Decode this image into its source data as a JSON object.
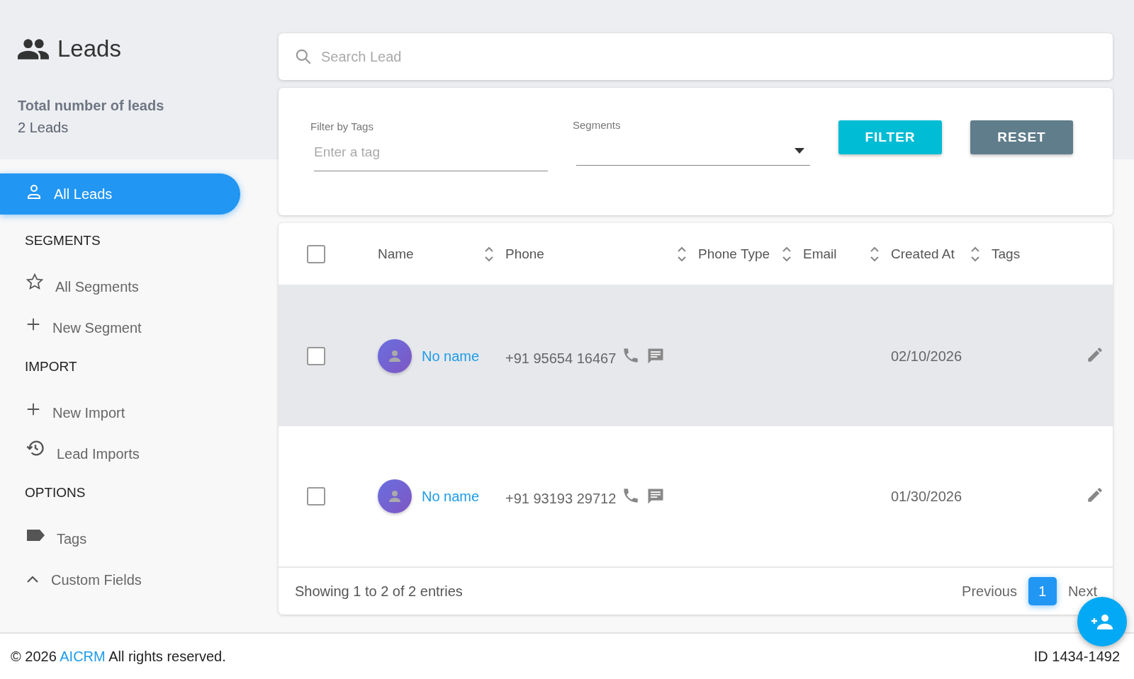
{
  "header": {
    "title": "Leads",
    "total_label": "Total number of leads",
    "total_value": "2 Leads"
  },
  "sidebar": {
    "items": [
      {
        "kind": "item",
        "label": "All Leads",
        "selected": true
      },
      {
        "kind": "heading",
        "label": "SEGMENTS"
      },
      {
        "kind": "item",
        "label": "All Segments",
        "selected": false
      },
      {
        "kind": "item",
        "label": "New Segment",
        "selected": false
      },
      {
        "kind": "heading",
        "label": "IMPORT"
      },
      {
        "kind": "item",
        "label": "New Import",
        "selected": false
      },
      {
        "kind": "item",
        "label": "Lead Imports",
        "selected": false
      },
      {
        "kind": "heading",
        "label": "OPTIONS"
      },
      {
        "kind": "item",
        "label": "Tags",
        "selected": false
      },
      {
        "kind": "item",
        "label": "Custom Fields",
        "selected": false
      }
    ]
  },
  "search": {
    "placeholder": "Search Lead"
  },
  "filters": {
    "tags_label": "Filter by Tags",
    "tags_placeholder": "Enter a tag",
    "segments_label": "Segments",
    "buttons": [
      {
        "kind": "primary",
        "label": "FILTER"
      },
      {
        "kind": "secondary",
        "label": "RESET"
      }
    ]
  },
  "table": {
    "select_all_checked": false,
    "columns": [
      "Name",
      "Phone",
      "Phone Type",
      "Email",
      "Created At",
      "Tags"
    ],
    "rows": [
      {
        "checked": false,
        "hovered": true,
        "name": "No name",
        "phone": "+91 95654 16467",
        "created_at": "02/10/2026"
      },
      {
        "checked": false,
        "hovered": false,
        "name": "No name",
        "phone": "+91 93193 29712",
        "created_at": "01/30/2026"
      }
    ],
    "info": "Showing 1 to 2 of 2 entries",
    "previous": "Previous",
    "pages": [
      {
        "label": "1",
        "selected": true
      }
    ],
    "next": "Next"
  },
  "footer": {
    "copyright": "© 2026",
    "brand": "AICRM",
    "rights": "All rights reserved.",
    "id": "ID 1434-1492"
  }
}
